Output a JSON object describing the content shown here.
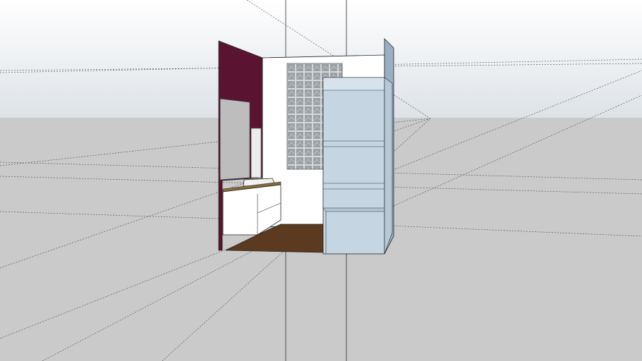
{
  "scene": {
    "sky_color_top": "#ffffff",
    "sky_color_bottom": "#dfe3e8",
    "ground_color": "#cacaca",
    "wall_accent_color": "#5a1431",
    "cabinet_color": "#c5d6e2",
    "floor_wood_color": "#5b3a1f",
    "glass_block_color": "#a9b0b4"
  }
}
